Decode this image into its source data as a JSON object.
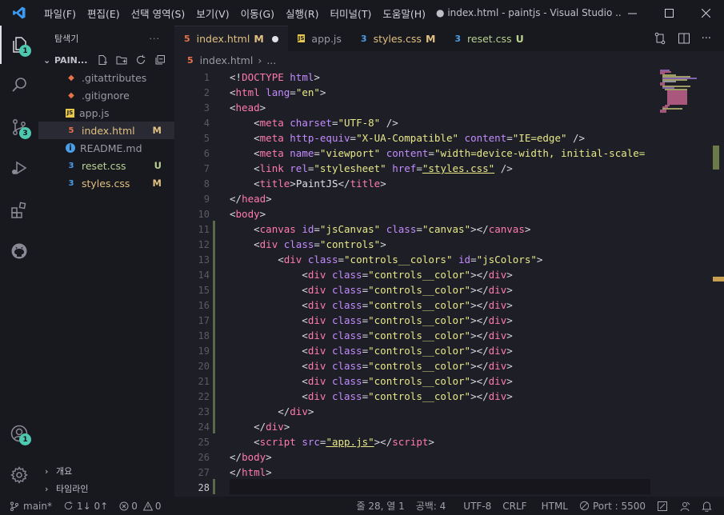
{
  "menu": [
    "파일(F)",
    "편집(E)",
    "선택 영역(S)",
    "보기(V)",
    "이동(G)",
    "실행(R)",
    "터미널(T)",
    "도움말(H)"
  ],
  "window_title": "● index.html - paintjs - Visual Studio ...",
  "activity_badges": {
    "explorer": "1",
    "scm": "3",
    "accounts": "1"
  },
  "sidebar": {
    "title": "탐색기",
    "more": "···",
    "project": "PAIN...",
    "files": [
      {
        "name": ".gitattributes",
        "icon": "git-icon",
        "status": ""
      },
      {
        "name": ".gitignore",
        "icon": "git-icon",
        "status": ""
      },
      {
        "name": "app.js",
        "icon": "js-icon",
        "status": ""
      },
      {
        "name": "index.html",
        "icon": "html-icon",
        "status": "M"
      },
      {
        "name": "README.md",
        "icon": "info-icon",
        "status": ""
      },
      {
        "name": "reset.css",
        "icon": "css-icon",
        "status": "U"
      },
      {
        "name": "styles.css",
        "icon": "css-icon",
        "status": "M"
      }
    ],
    "outline_label": "개요",
    "timeline_label": "타임라인"
  },
  "tabs": [
    {
      "name": "index.html",
      "status": "M",
      "kind": "html"
    },
    {
      "name": "app.js",
      "status": "",
      "kind": "js"
    },
    {
      "name": "styles.css",
      "status": "M",
      "kind": "css"
    },
    {
      "name": "reset.css",
      "status": "U",
      "kind": "css"
    }
  ],
  "breadcrumb": {
    "file": "index.html",
    "more": "..."
  },
  "code_lines": [
    {
      "n": "1",
      "tokens": [
        [
          "p",
          "<!"
        ],
        [
          "t",
          "DOCTYPE"
        ],
        [
          "p",
          " "
        ],
        [
          "a",
          "html"
        ],
        [
          "p",
          ">"
        ]
      ]
    },
    {
      "n": "2",
      "tokens": [
        [
          "p",
          "<"
        ],
        [
          "t",
          "html"
        ],
        [
          "p",
          " "
        ],
        [
          "a",
          "lang"
        ],
        [
          "p",
          "="
        ],
        [
          "s",
          "\"en\""
        ],
        [
          "p",
          ">"
        ]
      ]
    },
    {
      "n": "3",
      "tokens": [
        [
          "p",
          "<"
        ],
        [
          "t",
          "head"
        ],
        [
          "p",
          ">"
        ]
      ]
    },
    {
      "n": "4",
      "tokens": [
        [
          "p",
          "    <"
        ],
        [
          "t",
          "meta"
        ],
        [
          "p",
          " "
        ],
        [
          "a",
          "charset"
        ],
        [
          "p",
          "="
        ],
        [
          "s",
          "\"UTF-8\""
        ],
        [
          "p",
          " />"
        ]
      ]
    },
    {
      "n": "5",
      "tokens": [
        [
          "p",
          "    <"
        ],
        [
          "t",
          "meta"
        ],
        [
          "p",
          " "
        ],
        [
          "a",
          "http-equiv"
        ],
        [
          "p",
          "="
        ],
        [
          "s",
          "\"X-UA-Compatible\""
        ],
        [
          "p",
          " "
        ],
        [
          "a",
          "content"
        ],
        [
          "p",
          "="
        ],
        [
          "s",
          "\"IE=edge\""
        ],
        [
          "p",
          " />"
        ]
      ]
    },
    {
      "n": "6",
      "tokens": [
        [
          "p",
          "    <"
        ],
        [
          "t",
          "meta"
        ],
        [
          "p",
          " "
        ],
        [
          "a",
          "name"
        ],
        [
          "p",
          "="
        ],
        [
          "s",
          "\"viewport\""
        ],
        [
          "p",
          " "
        ],
        [
          "a",
          "content"
        ],
        [
          "p",
          "="
        ],
        [
          "s",
          "\"width=device-width, initial-scale="
        ]
      ]
    },
    {
      "n": "7",
      "tokens": [
        [
          "p",
          "    <"
        ],
        [
          "t",
          "link"
        ],
        [
          "p",
          " "
        ],
        [
          "a",
          "rel"
        ],
        [
          "p",
          "="
        ],
        [
          "s",
          "\"stylesheet\""
        ],
        [
          "p",
          " "
        ],
        [
          "a",
          "href"
        ],
        [
          "p",
          "="
        ],
        [
          "l",
          "\"styles.css\""
        ],
        [
          "p",
          " />"
        ]
      ]
    },
    {
      "n": "8",
      "tokens": [
        [
          "p",
          "    <"
        ],
        [
          "t",
          "title"
        ],
        [
          "p",
          ">"
        ],
        [
          "x",
          "PaintJS"
        ],
        [
          "p",
          "</"
        ],
        [
          "t",
          "title"
        ],
        [
          "p",
          ">"
        ]
      ]
    },
    {
      "n": "9",
      "tokens": [
        [
          "p",
          "</"
        ],
        [
          "t",
          "head"
        ],
        [
          "p",
          ">"
        ]
      ]
    },
    {
      "n": "10",
      "tokens": [
        [
          "p",
          "<"
        ],
        [
          "t",
          "body"
        ],
        [
          "p",
          ">"
        ]
      ]
    },
    {
      "n": "11",
      "tokens": [
        [
          "p",
          "    <"
        ],
        [
          "t",
          "canvas"
        ],
        [
          "p",
          " "
        ],
        [
          "a",
          "id"
        ],
        [
          "p",
          "="
        ],
        [
          "s",
          "\"jsCanvas\""
        ],
        [
          "p",
          " "
        ],
        [
          "a",
          "class"
        ],
        [
          "p",
          "="
        ],
        [
          "s",
          "\"canvas\""
        ],
        [
          "p",
          "></"
        ],
        [
          "t",
          "canvas"
        ],
        [
          "p",
          ">"
        ]
      ]
    },
    {
      "n": "12",
      "tokens": [
        [
          "p",
          "    <"
        ],
        [
          "t",
          "div"
        ],
        [
          "p",
          " "
        ],
        [
          "a",
          "class"
        ],
        [
          "p",
          "="
        ],
        [
          "s",
          "\"controls\""
        ],
        [
          "p",
          ">"
        ]
      ]
    },
    {
      "n": "13",
      "tokens": [
        [
          "p",
          "        <"
        ],
        [
          "t",
          "div"
        ],
        [
          "p",
          " "
        ],
        [
          "a",
          "class"
        ],
        [
          "p",
          "="
        ],
        [
          "s",
          "\"controls__colors\""
        ],
        [
          "p",
          " "
        ],
        [
          "a",
          "id"
        ],
        [
          "p",
          "="
        ],
        [
          "s",
          "\"jsColors\""
        ],
        [
          "p",
          ">"
        ]
      ]
    },
    {
      "n": "14",
      "tokens": [
        [
          "p",
          "            <"
        ],
        [
          "t",
          "div"
        ],
        [
          "p",
          " "
        ],
        [
          "a",
          "class"
        ],
        [
          "p",
          "="
        ],
        [
          "s",
          "\"controls__color\""
        ],
        [
          "p",
          "></"
        ],
        [
          "t",
          "div"
        ],
        [
          "p",
          ">"
        ]
      ]
    },
    {
      "n": "15",
      "tokens": [
        [
          "p",
          "            <"
        ],
        [
          "t",
          "div"
        ],
        [
          "p",
          " "
        ],
        [
          "a",
          "class"
        ],
        [
          "p",
          "="
        ],
        [
          "s",
          "\"controls__color\""
        ],
        [
          "p",
          "></"
        ],
        [
          "t",
          "div"
        ],
        [
          "p",
          ">"
        ]
      ]
    },
    {
      "n": "16",
      "tokens": [
        [
          "p",
          "            <"
        ],
        [
          "t",
          "div"
        ],
        [
          "p",
          " "
        ],
        [
          "a",
          "class"
        ],
        [
          "p",
          "="
        ],
        [
          "s",
          "\"controls__color\""
        ],
        [
          "p",
          "></"
        ],
        [
          "t",
          "div"
        ],
        [
          "p",
          ">"
        ]
      ]
    },
    {
      "n": "17",
      "tokens": [
        [
          "p",
          "            <"
        ],
        [
          "t",
          "div"
        ],
        [
          "p",
          " "
        ],
        [
          "a",
          "class"
        ],
        [
          "p",
          "="
        ],
        [
          "s",
          "\"controls__color\""
        ],
        [
          "p",
          "></"
        ],
        [
          "t",
          "div"
        ],
        [
          "p",
          ">"
        ]
      ]
    },
    {
      "n": "18",
      "tokens": [
        [
          "p",
          "            <"
        ],
        [
          "t",
          "div"
        ],
        [
          "p",
          " "
        ],
        [
          "a",
          "class"
        ],
        [
          "p",
          "="
        ],
        [
          "s",
          "\"controls__color\""
        ],
        [
          "p",
          "></"
        ],
        [
          "t",
          "div"
        ],
        [
          "p",
          ">"
        ]
      ]
    },
    {
      "n": "19",
      "tokens": [
        [
          "p",
          "            <"
        ],
        [
          "t",
          "div"
        ],
        [
          "p",
          " "
        ],
        [
          "a",
          "class"
        ],
        [
          "p",
          "="
        ],
        [
          "s",
          "\"controls__color\""
        ],
        [
          "p",
          "></"
        ],
        [
          "t",
          "div"
        ],
        [
          "p",
          ">"
        ]
      ]
    },
    {
      "n": "20",
      "tokens": [
        [
          "p",
          "            <"
        ],
        [
          "t",
          "div"
        ],
        [
          "p",
          " "
        ],
        [
          "a",
          "class"
        ],
        [
          "p",
          "="
        ],
        [
          "s",
          "\"controls__color\""
        ],
        [
          "p",
          "></"
        ],
        [
          "t",
          "div"
        ],
        [
          "p",
          ">"
        ]
      ]
    },
    {
      "n": "21",
      "tokens": [
        [
          "p",
          "            <"
        ],
        [
          "t",
          "div"
        ],
        [
          "p",
          " "
        ],
        [
          "a",
          "class"
        ],
        [
          "p",
          "="
        ],
        [
          "s",
          "\"controls__color\""
        ],
        [
          "p",
          "></"
        ],
        [
          "t",
          "div"
        ],
        [
          "p",
          ">"
        ]
      ]
    },
    {
      "n": "22",
      "tokens": [
        [
          "p",
          "            <"
        ],
        [
          "t",
          "div"
        ],
        [
          "p",
          " "
        ],
        [
          "a",
          "class"
        ],
        [
          "p",
          "="
        ],
        [
          "s",
          "\"controls__color\""
        ],
        [
          "p",
          "></"
        ],
        [
          "t",
          "div"
        ],
        [
          "p",
          ">"
        ]
      ]
    },
    {
      "n": "23",
      "tokens": [
        [
          "p",
          "        </"
        ],
        [
          "t",
          "div"
        ],
        [
          "p",
          ">"
        ]
      ]
    },
    {
      "n": "24",
      "tokens": [
        [
          "p",
          "    </"
        ],
        [
          "t",
          "div"
        ],
        [
          "p",
          ">"
        ]
      ]
    },
    {
      "n": "25",
      "tokens": [
        [
          "p",
          "    <"
        ],
        [
          "t",
          "script"
        ],
        [
          "p",
          " "
        ],
        [
          "a",
          "src"
        ],
        [
          "p",
          "="
        ],
        [
          "l",
          "\"app.js\""
        ],
        [
          "p",
          "></"
        ],
        [
          "t",
          "script"
        ],
        [
          "p",
          ">"
        ]
      ]
    },
    {
      "n": "26",
      "tokens": [
        [
          "p",
          "</"
        ],
        [
          "t",
          "body"
        ],
        [
          "p",
          ">"
        ]
      ]
    },
    {
      "n": "27",
      "tokens": [
        [
          "p",
          "</"
        ],
        [
          "t",
          "html"
        ],
        [
          "p",
          ">"
        ]
      ]
    },
    {
      "n": "28",
      "tokens": []
    }
  ],
  "status": {
    "branch": "main*",
    "sync": "1↓ 0↑",
    "problems": "0",
    "warnings": "0",
    "position": "줄 28, 열 1",
    "spaces": "공백: 4",
    "encoding": "UTF-8",
    "eol": "CRLF",
    "language": "HTML",
    "port": "Port : 5500"
  },
  "colors": {
    "tag": "#ff7ab2",
    "attr": "#c38cff",
    "string": "#e8e88a",
    "html_icon": "#e8734a",
    "js_icon": "#e8c84a",
    "css_icon": "#4a9ee8",
    "modified": "#e0c080",
    "untracked": "#b8d090",
    "badge": "#4ec9b0"
  }
}
